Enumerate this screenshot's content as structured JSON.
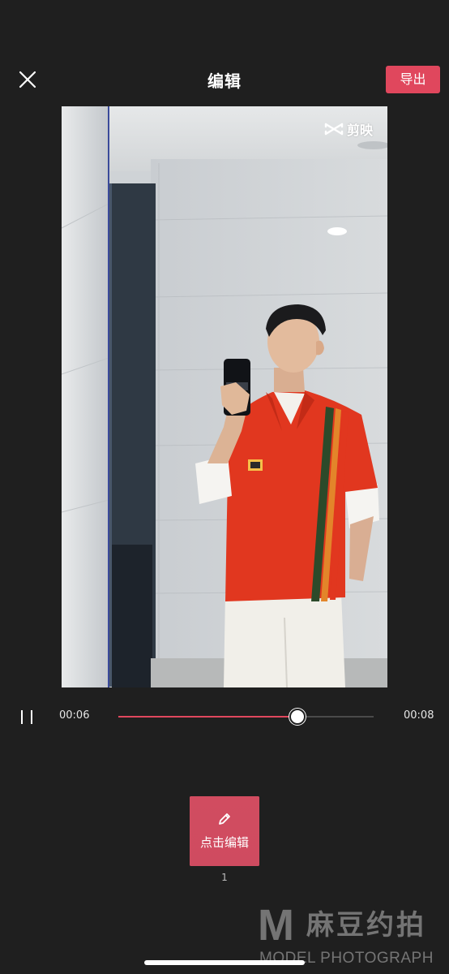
{
  "header": {
    "title": "编辑",
    "export_label": "导出",
    "close_icon": "close-icon"
  },
  "preview": {
    "watermark_text": "剪映",
    "watermark_icon": "capcut-logo-icon",
    "description": "video-preview"
  },
  "playback": {
    "state_icon": "pause-icon",
    "current_time": "00:06",
    "total_time": "00:08",
    "progress_fraction": 0.7
  },
  "clips": [
    {
      "label": "点击编辑",
      "index": "1",
      "icon": "pencil-icon"
    }
  ],
  "brand_watermark": {
    "logo_letter": "M",
    "cn_text": "麻豆约拍",
    "en_text": "MODEL PHOTOGRAPH"
  },
  "colors": {
    "background": "#1f1f1f",
    "accent": "#e0475d",
    "clip_tile": "#d9546a"
  }
}
